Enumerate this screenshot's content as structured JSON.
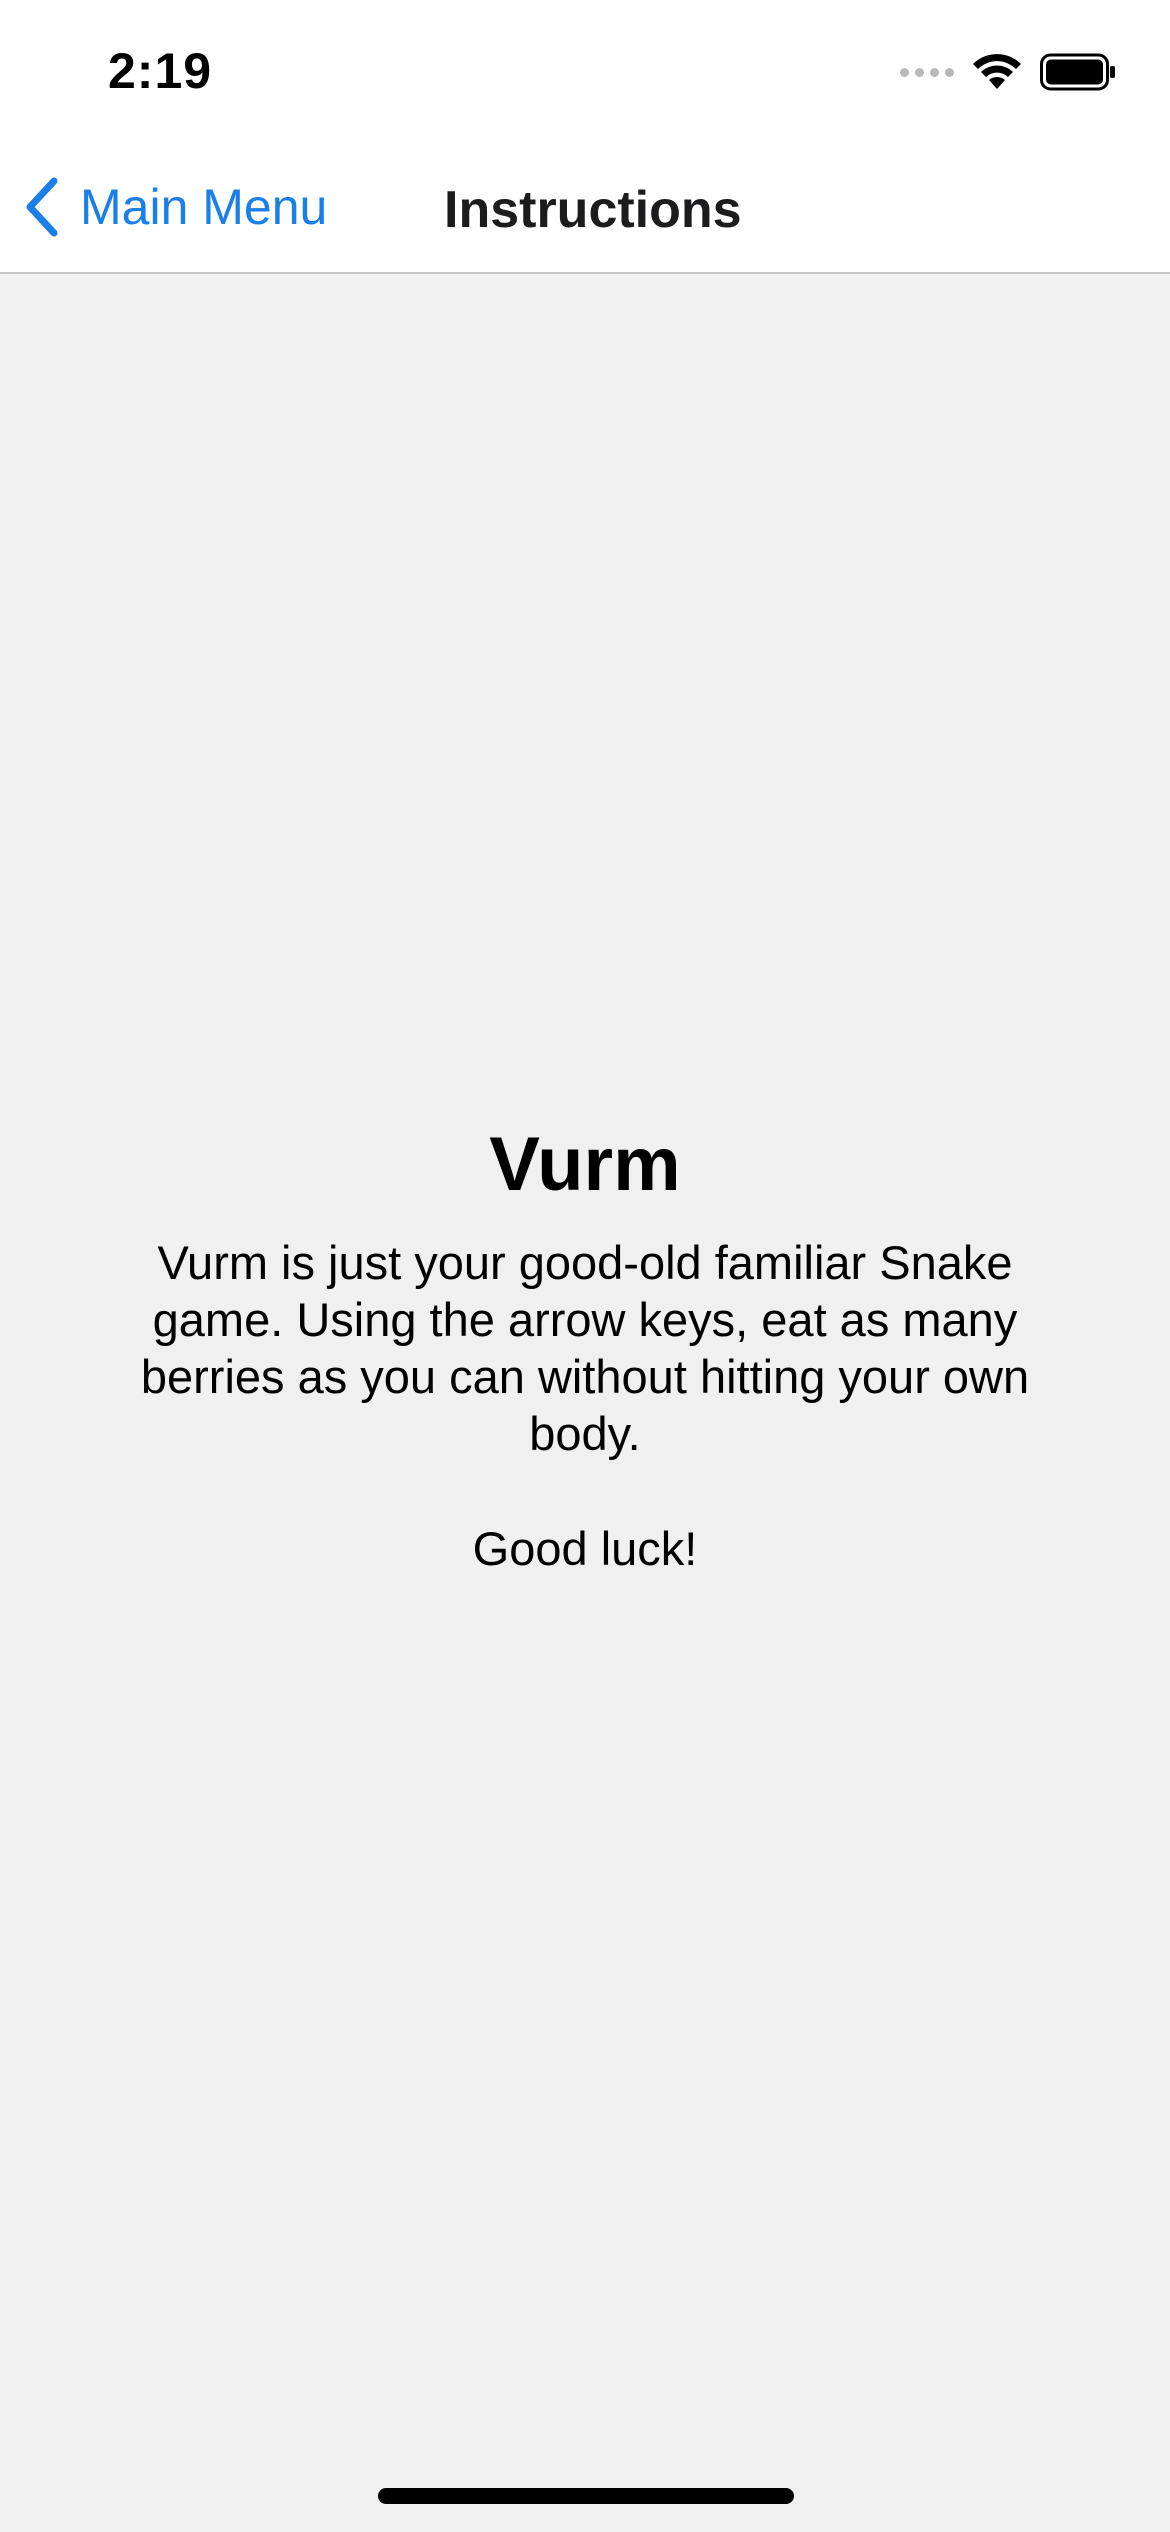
{
  "status_bar": {
    "time": "2:19",
    "icons": [
      "signal-dots-icon",
      "wifi-icon",
      "battery-icon"
    ]
  },
  "nav": {
    "back_label": "Main Menu",
    "title": "Instructions",
    "accent_color": "#1a7fe6"
  },
  "content": {
    "title": "Vurm",
    "description": "Vurm is just your good-old familiar Snake game. Using the arrow keys, eat as many berries as you can without hitting your own body.",
    "closing": "Good luck!"
  },
  "colors": {
    "background": "#f0f0f0",
    "bar_background": "#ffffff"
  }
}
